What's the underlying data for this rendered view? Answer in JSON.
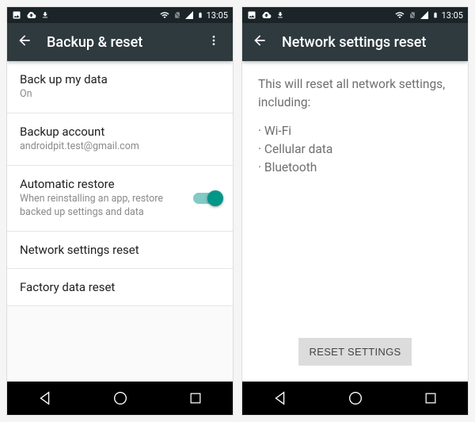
{
  "status": {
    "time": "13:05"
  },
  "left": {
    "appbar": {
      "title": "Backup & reset"
    },
    "items": {
      "backup_data": {
        "title": "Back up my data",
        "subtitle": "On"
      },
      "backup_account": {
        "title": "Backup account",
        "subtitle": "androidpit.test@gmail.com"
      },
      "auto_restore": {
        "title": "Automatic restore",
        "subtitle": "When reinstalling an app, restore backed up settings and data"
      },
      "network_reset": {
        "title": "Network settings reset"
      },
      "factory_reset": {
        "title": "Factory data reset"
      }
    }
  },
  "right": {
    "appbar": {
      "title": "Network settings reset"
    },
    "description": "This will reset all network settings, including:",
    "list": {
      "wifi": "Wi-Fi",
      "cellular": "Cellular data",
      "bluetooth": "Bluetooth"
    },
    "button": "RESET SETTINGS"
  },
  "colors": {
    "accent": "#009688",
    "appbar": "#2f3a3f",
    "status": "#1b2428"
  }
}
